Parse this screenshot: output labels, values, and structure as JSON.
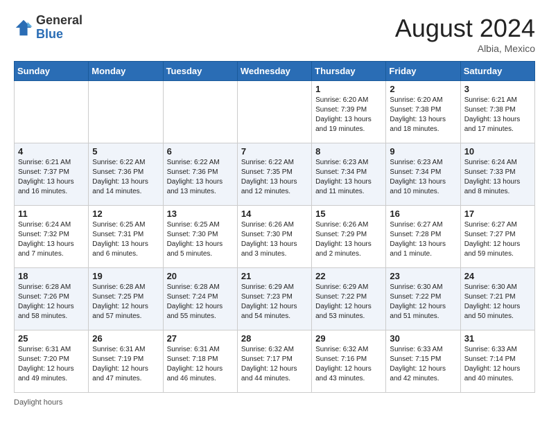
{
  "header": {
    "logo_general": "General",
    "logo_blue": "Blue",
    "month_title": "August 2024",
    "subtitle": "Albia, Mexico"
  },
  "footer": {
    "daylight_label": "Daylight hours"
  },
  "weekdays": [
    "Sunday",
    "Monday",
    "Tuesday",
    "Wednesday",
    "Thursday",
    "Friday",
    "Saturday"
  ],
  "weeks": [
    [
      {
        "day": "",
        "info": ""
      },
      {
        "day": "",
        "info": ""
      },
      {
        "day": "",
        "info": ""
      },
      {
        "day": "",
        "info": ""
      },
      {
        "day": "1",
        "info": "Sunrise: 6:20 AM\nSunset: 7:39 PM\nDaylight: 13 hours\nand 19 minutes."
      },
      {
        "day": "2",
        "info": "Sunrise: 6:20 AM\nSunset: 7:38 PM\nDaylight: 13 hours\nand 18 minutes."
      },
      {
        "day": "3",
        "info": "Sunrise: 6:21 AM\nSunset: 7:38 PM\nDaylight: 13 hours\nand 17 minutes."
      }
    ],
    [
      {
        "day": "4",
        "info": "Sunrise: 6:21 AM\nSunset: 7:37 PM\nDaylight: 13 hours\nand 16 minutes."
      },
      {
        "day": "5",
        "info": "Sunrise: 6:22 AM\nSunset: 7:36 PM\nDaylight: 13 hours\nand 14 minutes."
      },
      {
        "day": "6",
        "info": "Sunrise: 6:22 AM\nSunset: 7:36 PM\nDaylight: 13 hours\nand 13 minutes."
      },
      {
        "day": "7",
        "info": "Sunrise: 6:22 AM\nSunset: 7:35 PM\nDaylight: 13 hours\nand 12 minutes."
      },
      {
        "day": "8",
        "info": "Sunrise: 6:23 AM\nSunset: 7:34 PM\nDaylight: 13 hours\nand 11 minutes."
      },
      {
        "day": "9",
        "info": "Sunrise: 6:23 AM\nSunset: 7:34 PM\nDaylight: 13 hours\nand 10 minutes."
      },
      {
        "day": "10",
        "info": "Sunrise: 6:24 AM\nSunset: 7:33 PM\nDaylight: 13 hours\nand 8 minutes."
      }
    ],
    [
      {
        "day": "11",
        "info": "Sunrise: 6:24 AM\nSunset: 7:32 PM\nDaylight: 13 hours\nand 7 minutes."
      },
      {
        "day": "12",
        "info": "Sunrise: 6:25 AM\nSunset: 7:31 PM\nDaylight: 13 hours\nand 6 minutes."
      },
      {
        "day": "13",
        "info": "Sunrise: 6:25 AM\nSunset: 7:30 PM\nDaylight: 13 hours\nand 5 minutes."
      },
      {
        "day": "14",
        "info": "Sunrise: 6:26 AM\nSunset: 7:30 PM\nDaylight: 13 hours\nand 3 minutes."
      },
      {
        "day": "15",
        "info": "Sunrise: 6:26 AM\nSunset: 7:29 PM\nDaylight: 13 hours\nand 2 minutes."
      },
      {
        "day": "16",
        "info": "Sunrise: 6:27 AM\nSunset: 7:28 PM\nDaylight: 13 hours\nand 1 minute."
      },
      {
        "day": "17",
        "info": "Sunrise: 6:27 AM\nSunset: 7:27 PM\nDaylight: 12 hours\nand 59 minutes."
      }
    ],
    [
      {
        "day": "18",
        "info": "Sunrise: 6:28 AM\nSunset: 7:26 PM\nDaylight: 12 hours\nand 58 minutes."
      },
      {
        "day": "19",
        "info": "Sunrise: 6:28 AM\nSunset: 7:25 PM\nDaylight: 12 hours\nand 57 minutes."
      },
      {
        "day": "20",
        "info": "Sunrise: 6:28 AM\nSunset: 7:24 PM\nDaylight: 12 hours\nand 55 minutes."
      },
      {
        "day": "21",
        "info": "Sunrise: 6:29 AM\nSunset: 7:23 PM\nDaylight: 12 hours\nand 54 minutes."
      },
      {
        "day": "22",
        "info": "Sunrise: 6:29 AM\nSunset: 7:22 PM\nDaylight: 12 hours\nand 53 minutes."
      },
      {
        "day": "23",
        "info": "Sunrise: 6:30 AM\nSunset: 7:22 PM\nDaylight: 12 hours\nand 51 minutes."
      },
      {
        "day": "24",
        "info": "Sunrise: 6:30 AM\nSunset: 7:21 PM\nDaylight: 12 hours\nand 50 minutes."
      }
    ],
    [
      {
        "day": "25",
        "info": "Sunrise: 6:31 AM\nSunset: 7:20 PM\nDaylight: 12 hours\nand 49 minutes."
      },
      {
        "day": "26",
        "info": "Sunrise: 6:31 AM\nSunset: 7:19 PM\nDaylight: 12 hours\nand 47 minutes."
      },
      {
        "day": "27",
        "info": "Sunrise: 6:31 AM\nSunset: 7:18 PM\nDaylight: 12 hours\nand 46 minutes."
      },
      {
        "day": "28",
        "info": "Sunrise: 6:32 AM\nSunset: 7:17 PM\nDaylight: 12 hours\nand 44 minutes."
      },
      {
        "day": "29",
        "info": "Sunrise: 6:32 AM\nSunset: 7:16 PM\nDaylight: 12 hours\nand 43 minutes."
      },
      {
        "day": "30",
        "info": "Sunrise: 6:33 AM\nSunset: 7:15 PM\nDaylight: 12 hours\nand 42 minutes."
      },
      {
        "day": "31",
        "info": "Sunrise: 6:33 AM\nSunset: 7:14 PM\nDaylight: 12 hours\nand 40 minutes."
      }
    ]
  ]
}
